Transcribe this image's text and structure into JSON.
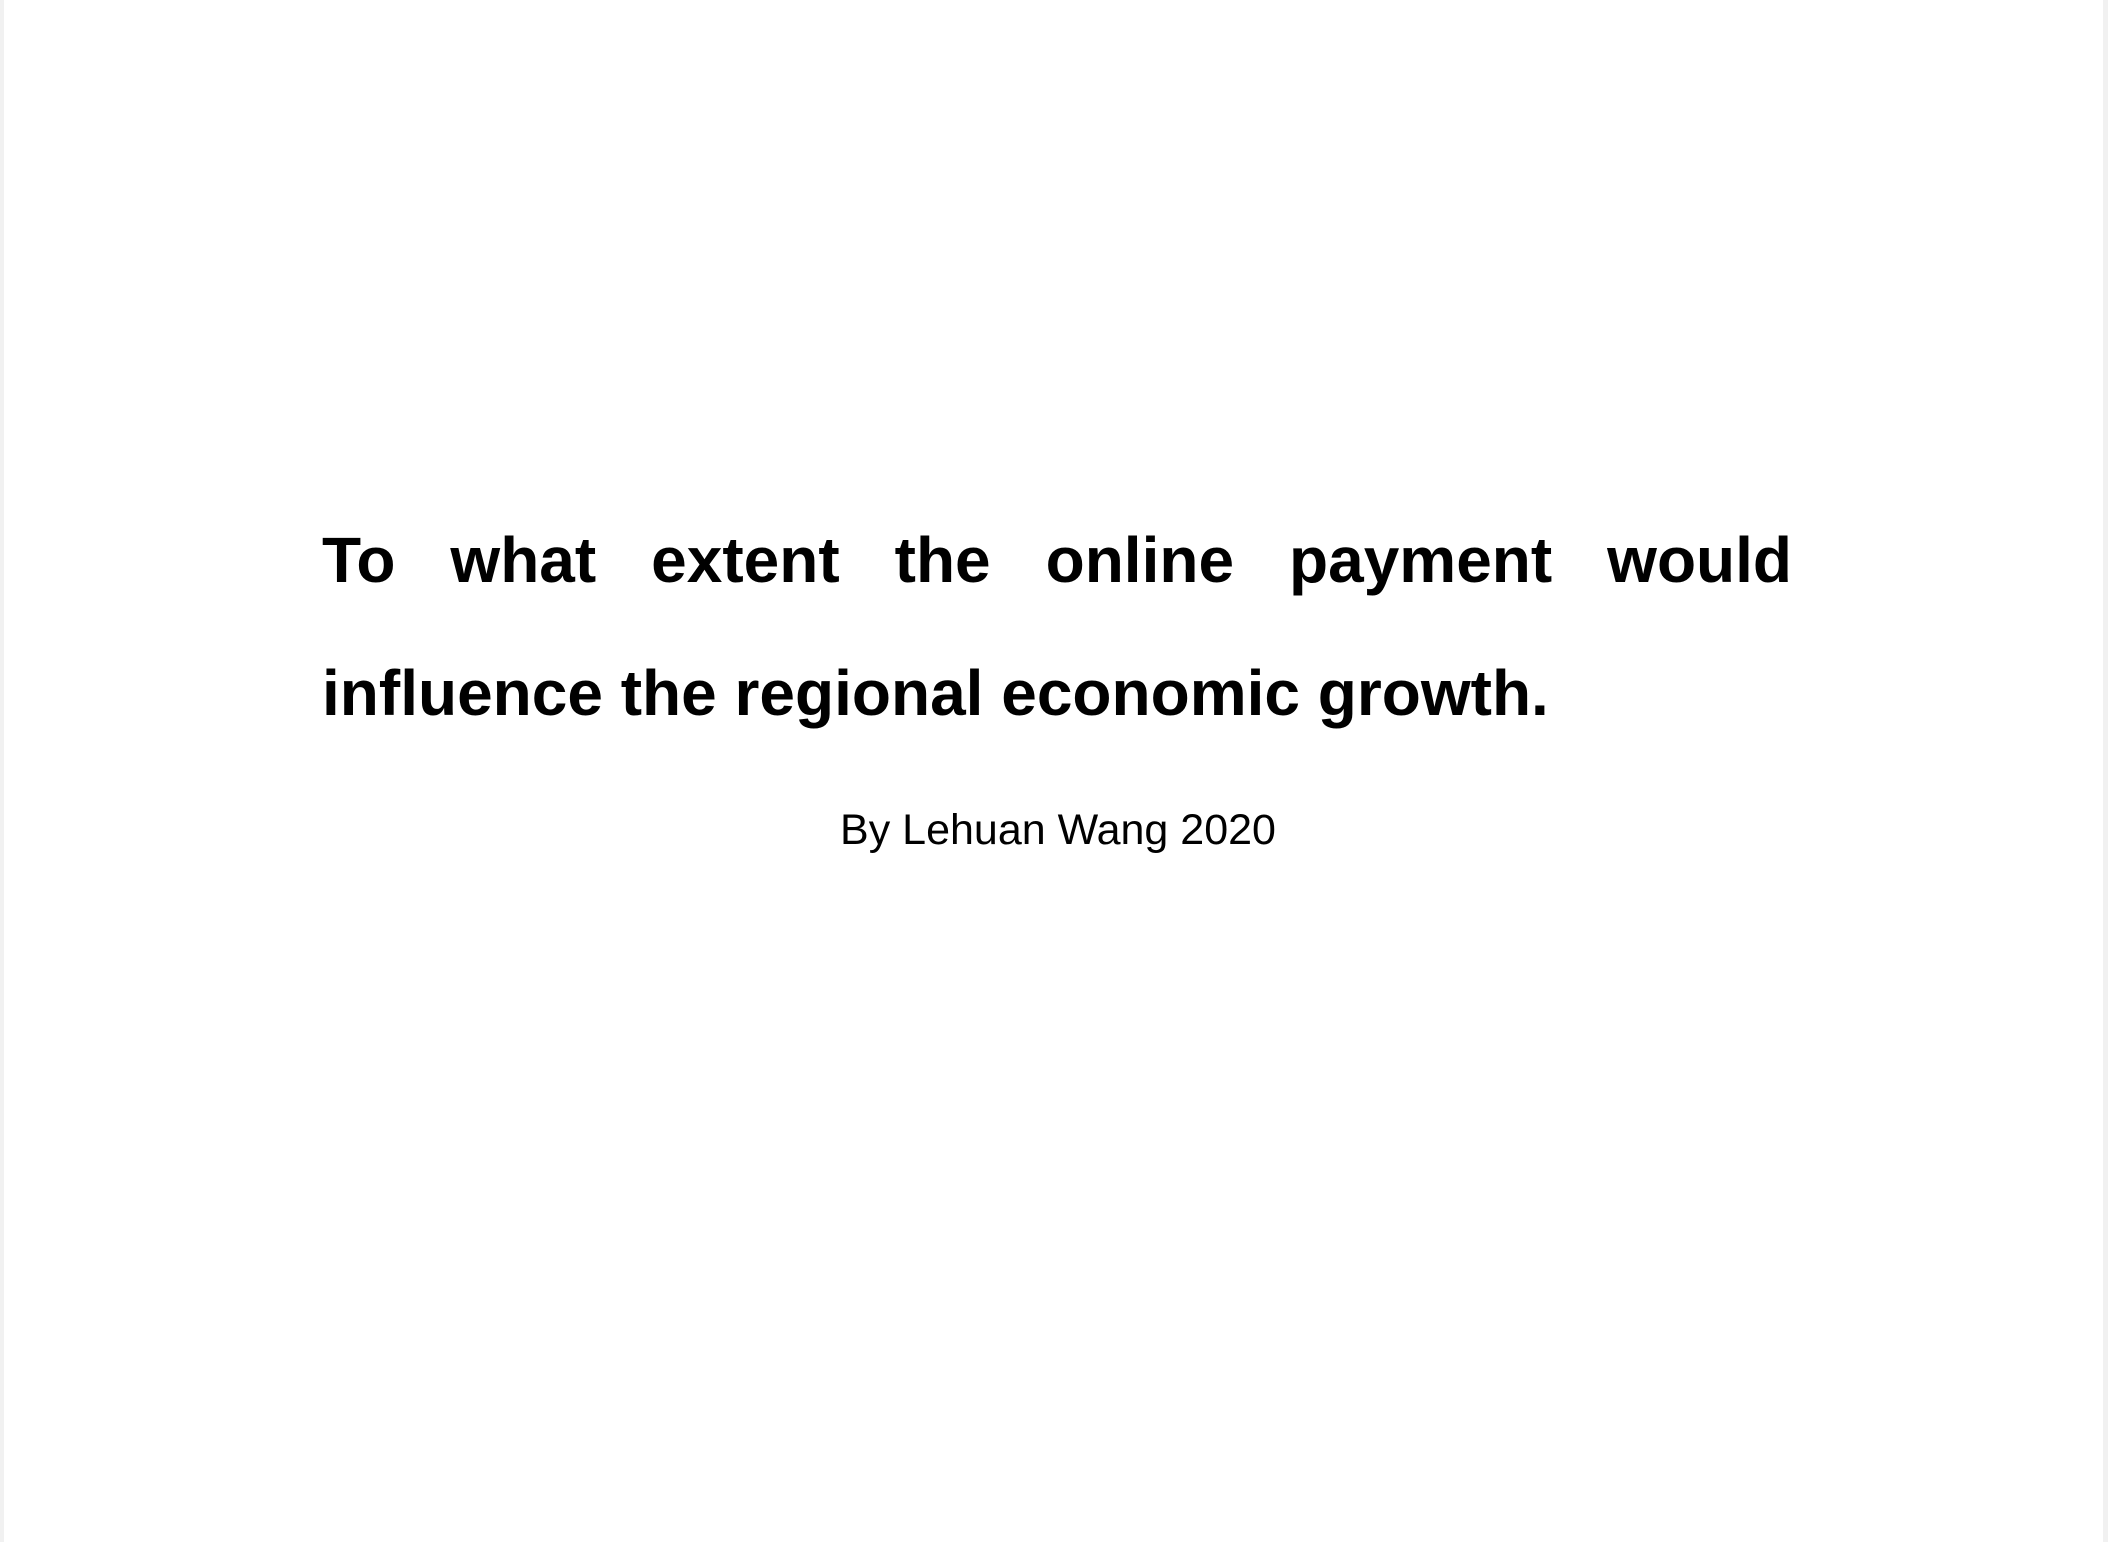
{
  "document": {
    "title": "To what extent the online payment would influence the regional economic growth.",
    "author_line": "By Lehuan Wang 2020"
  }
}
